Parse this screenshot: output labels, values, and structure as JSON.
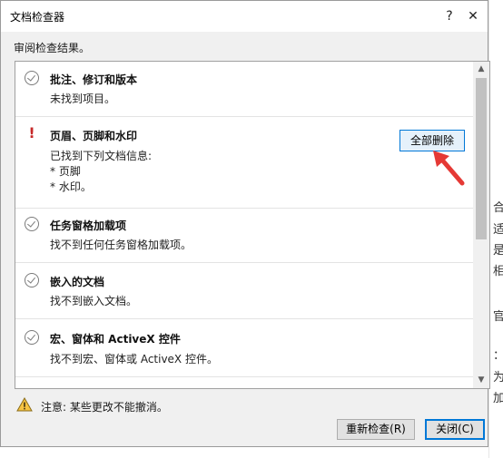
{
  "background_document": {
    "chars": [
      "合",
      "适",
      "是",
      "相",
      "官",
      "：",
      "为",
      "加"
    ]
  },
  "window": {
    "title": "文档检查器",
    "help_label": "?",
    "close_label": "✕"
  },
  "heading": "审阅检查结果。",
  "sections": [
    {
      "status": "ok",
      "icon": "check-circle-icon",
      "title": "批注、修订和版本",
      "lines": [
        "未找到项目。"
      ]
    },
    {
      "status": "found",
      "icon": "exclamation-icon",
      "title": "页眉、页脚和水印",
      "lines": [
        "已找到下列文档信息:",
        "* 页脚",
        "* 水印。"
      ],
      "action_label": "全部删除"
    },
    {
      "status": "ok",
      "icon": "check-circle-icon",
      "title": "任务窗格加载项",
      "lines": [
        "找不到任何任务窗格加载项。"
      ]
    },
    {
      "status": "ok",
      "icon": "check-circle-icon",
      "title": "嵌入的文档",
      "lines": [
        "找不到嵌入文档。"
      ]
    },
    {
      "status": "ok",
      "icon": "check-circle-icon",
      "title": "宏、窗体和 ActiveX 控件",
      "lines": [
        "找不到宏、窗体或 ActiveX 控件。"
      ]
    }
  ],
  "scrollbar": {
    "up_arrow": "▲",
    "down_arrow": "▼"
  },
  "note": {
    "icon": "warning-triangle-icon",
    "text": "注意: 某些更改不能撤消。"
  },
  "buttons": {
    "reinspect": "重新检查(R)",
    "close": "关闭(C)"
  },
  "colors": {
    "accent": "#0078d7",
    "warning": "#c62828",
    "arrow": "#e53935",
    "dialog_bg": "#f0f0f0"
  }
}
